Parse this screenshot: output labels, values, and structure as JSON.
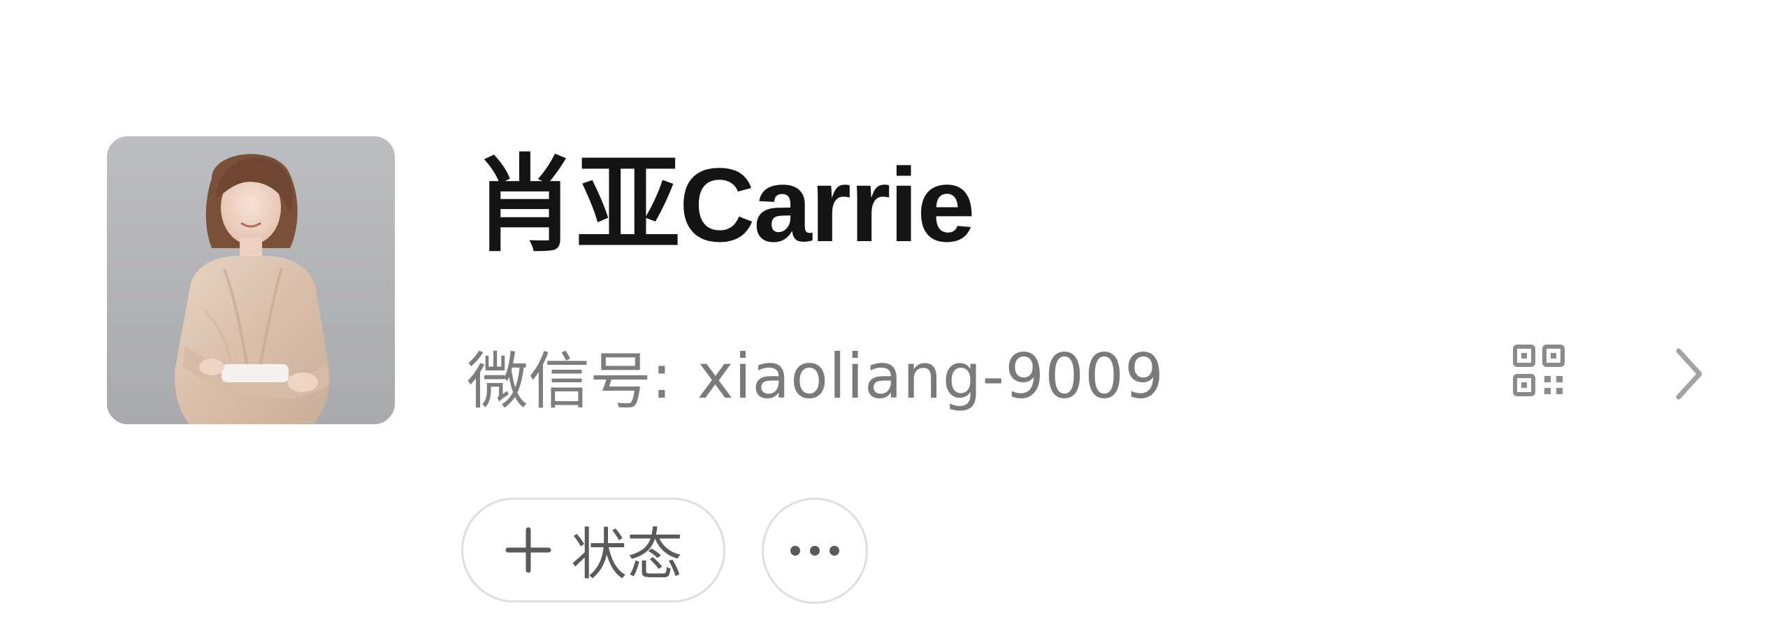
{
  "profile": {
    "name": "肖亚Carrie",
    "wechat_label": "微信号",
    "wechat_separator": ":",
    "wechat_id": "xiaoliang-9009",
    "avatar_icon": "avatar-photo"
  },
  "actions": {
    "status_label": "状态",
    "status_icon": "plus-icon",
    "more_icon": "more-icon",
    "qr_icon": "qr-code-icon",
    "chevron_icon": "chevron-right-icon"
  },
  "colors": {
    "background": "#ffffff",
    "name_text": "#141414",
    "secondary_text": "#7d7d7d",
    "button_border": "#dedede",
    "icon_gray": "#8a8a8a"
  }
}
